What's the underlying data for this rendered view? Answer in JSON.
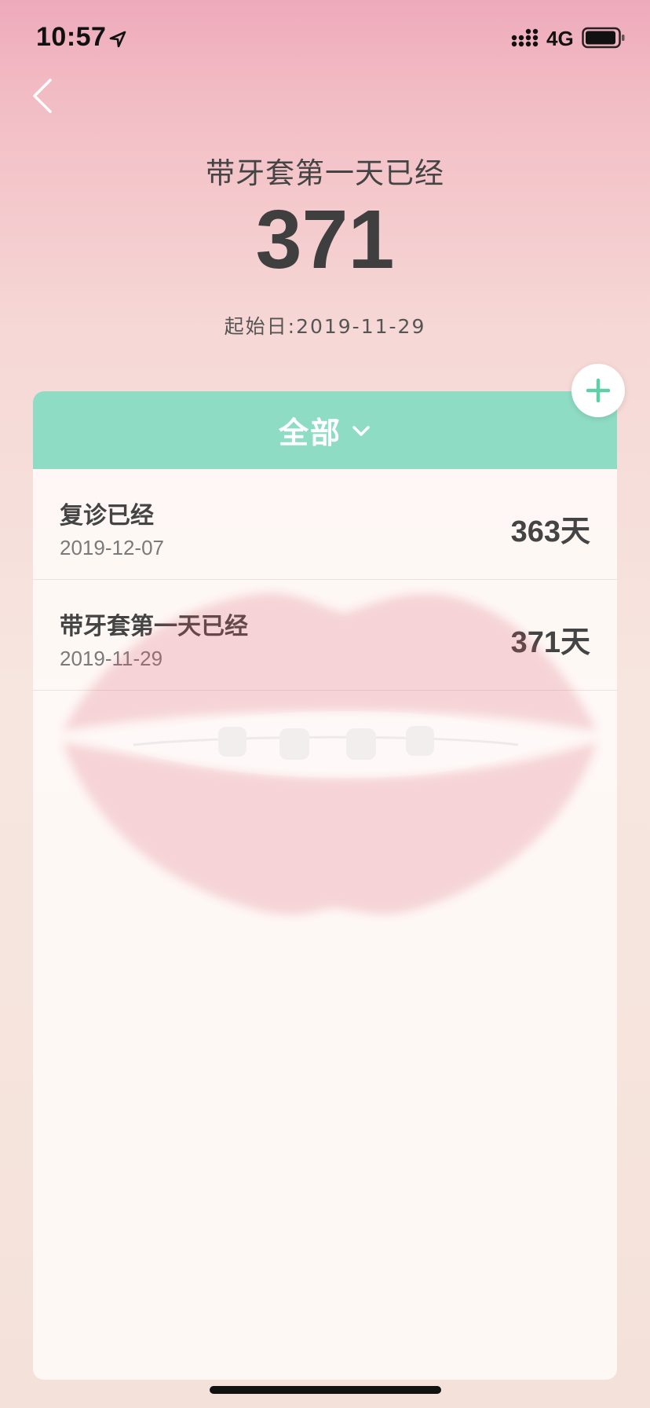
{
  "status_bar": {
    "time": "10:57",
    "network": "4G"
  },
  "header": {
    "title": "带牙套第一天已经",
    "count": "371",
    "start_date": "起始日:2019-11-29"
  },
  "filter": {
    "label": "全部"
  },
  "events": [
    {
      "title": "复诊已经",
      "date": "2019-12-07",
      "days": "363",
      "unit": "天"
    },
    {
      "title": "带牙套第一天已经",
      "date": "2019-11-29",
      "days": "371",
      "unit": "天"
    }
  ],
  "colors": {
    "accent": "#8fdcc5",
    "plus": "#5fcfa8",
    "text": "#444444"
  },
  "icons": [
    "location-arrow-icon",
    "signal-icon",
    "battery-icon",
    "back-chevron-icon",
    "chevron-down-icon",
    "plus-icon"
  ]
}
